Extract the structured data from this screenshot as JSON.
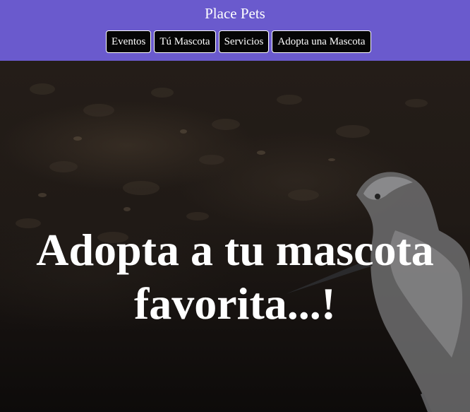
{
  "header": {
    "brand": "Place Pets",
    "nav": [
      {
        "label": "Eventos"
      },
      {
        "label": "Tú Mascota"
      },
      {
        "label": "Servicios"
      },
      {
        "label": "Adopta una Mascota"
      }
    ]
  },
  "hero": {
    "headline_line1": "Adopta a tu mascota",
    "headline_line2": "favorita...!",
    "image": "egret-bird-photo"
  },
  "colors": {
    "header_bg": "#6a5acd",
    "button_bg": "#050505",
    "text": "#ffffff"
  }
}
